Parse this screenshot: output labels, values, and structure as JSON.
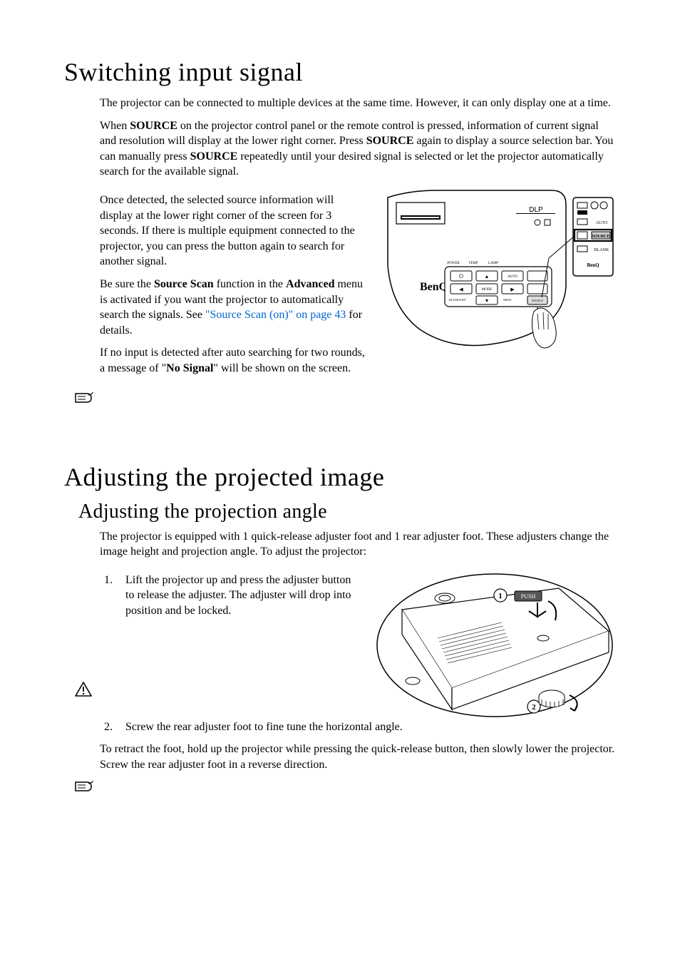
{
  "section1": {
    "title": "Switching input signal",
    "p1": "The projector can be connected to multiple devices at the same time. However, it can only display one at a time.",
    "p2_a": "When ",
    "p2_b_bold": "SOURCE",
    "p2_c": " on the projector control panel or the remote control is pressed, information of current signal and resolution will display at the lower right corner. Press ",
    "p2_d_bold": "SOURCE",
    "p2_e": " again to display  a source selection bar. You can manually press ",
    "p2_f_bold": "SOURCE",
    "p2_g": " repeatedly until your desired signal is selected or let the projector automatically search for the available signal.",
    "p3": "Once detected, the selected source information will display at the lower right corner of the screen for 3 seconds. If there is multiple equipment connected to the projector, you can press the button again to search for another signal.",
    "p4_a": "Be sure the ",
    "p4_b_bold": "Source Scan",
    "p4_c": " function in the ",
    "p4_d_bold": "Advanced",
    "p4_e": " menu is activated if you want the projector to automatically search the signals. See ",
    "p4_link": "\"Source Scan (on)\" on page 43",
    "p4_f": " for details.",
    "p5_a": "If no input is detected after auto searching for two rounds, a message of \"",
    "p5_b_bold": "No Signal",
    "p5_c": "\" will be shown on the screen.",
    "fig": {
      "brand": "BenQ",
      "dlp_label": "DLP",
      "panel_labels": {
        "power": "POWER",
        "temp": "TEMP",
        "lamp": "LAMP"
      },
      "remote": {
        "auto": "AUTO",
        "source": "SOURCE",
        "blank": "BLANK"
      },
      "panel_buttons": {
        "auto": "AUTO",
        "mode": "MODE",
        "blank_exit": "BLANK/EXIT",
        "menu": "MENU",
        "source": "SOURCE",
        "power_sym": "⏻",
        "up": "▲",
        "down": "▼",
        "left": "◀",
        "right": "▶"
      }
    }
  },
  "section2": {
    "title": "Adjusting the projected image",
    "subtitle": "Adjusting the projection angle",
    "p1": "The projector is equipped with 1 quick-release adjuster foot and 1 rear adjuster foot. These adjusters change the image height and projection angle. To adjust the projector:",
    "li1": "Lift the projector up and press the adjuster button to release the adjuster. The adjuster will drop into position and be locked.",
    "li2": "Screw the rear adjuster foot to fine tune the horizontal angle.",
    "p2": "To retract the foot, hold up the projector while pressing the quick-release button, then slowly lower the projector. Screw the rear adjuster foot in a reverse direction.",
    "fig": {
      "callout1": "1",
      "callout2": "2",
      "push": "PUSH"
    }
  }
}
